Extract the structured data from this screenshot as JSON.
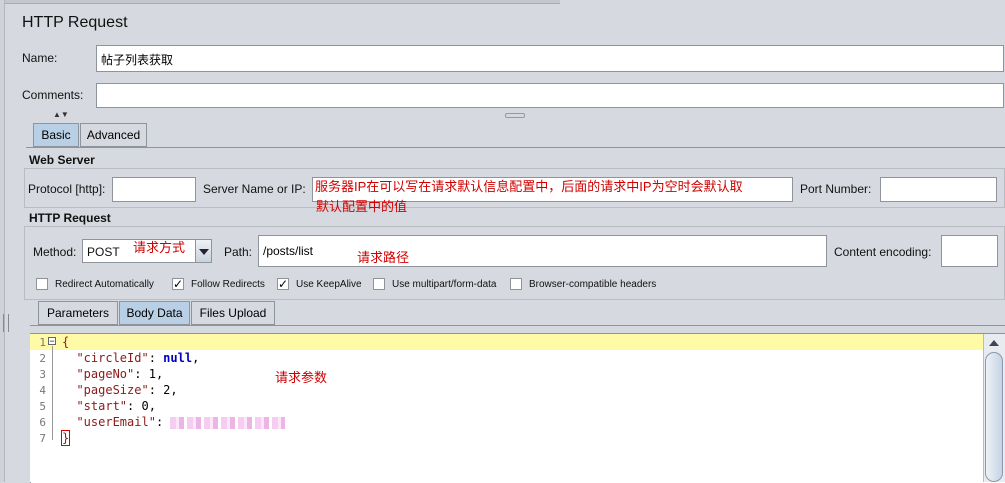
{
  "title": "HTTP Request",
  "name": {
    "label": "Name:",
    "value": "帖子列表获取"
  },
  "comments": {
    "label": "Comments:",
    "value": ""
  },
  "tabs": [
    "Basic",
    "Advanced"
  ],
  "web_server": {
    "heading": "Web Server",
    "protocol_label": "Protocol [http]:",
    "protocol_value": "",
    "server_label": "Server Name or IP:",
    "server_value": "服务器IP在可以写在请求默认信息配置中，后面的请求中IP为空时会默认取",
    "server_value_overflow": "默认配置中的值",
    "port_label": "Port Number:",
    "port_value": ""
  },
  "http_request": {
    "heading": "HTTP Request",
    "method_label": "Method:",
    "method_value": "POST",
    "method_note": "请求方式",
    "path_label": "Path:",
    "path_value": "/posts/list",
    "path_note": "请求路径",
    "encoding_label": "Content encoding:",
    "encoding_value": ""
  },
  "checkboxes": [
    {
      "label": "Redirect Automatically",
      "checked": false
    },
    {
      "label": "Follow Redirects",
      "checked": true
    },
    {
      "label": "Use KeepAlive",
      "checked": true
    },
    {
      "label": "Use multipart/form-data",
      "checked": false
    },
    {
      "label": "Browser-compatible headers",
      "checked": false
    }
  ],
  "body_tabs": [
    "Parameters",
    "Body Data",
    "Files Upload"
  ],
  "body_tab_selected": "Body Data",
  "editor": {
    "line_numbers": [
      "1",
      "2",
      "3",
      "4",
      "5",
      "6",
      "7"
    ],
    "lines": [
      {
        "key": "{",
        "value": ""
      },
      {
        "key": "\"circleId\"",
        "value": "null"
      },
      {
        "key": "\"pageNo\"",
        "value": "1"
      },
      {
        "key": "\"pageSize\"",
        "value": "2"
      },
      {
        "key": "\"start\"",
        "value": "0"
      },
      {
        "key": "\"userEmail\"",
        "value": ""
      },
      {
        "key": "}",
        "value": ""
      }
    ],
    "note": "请求参数"
  }
}
